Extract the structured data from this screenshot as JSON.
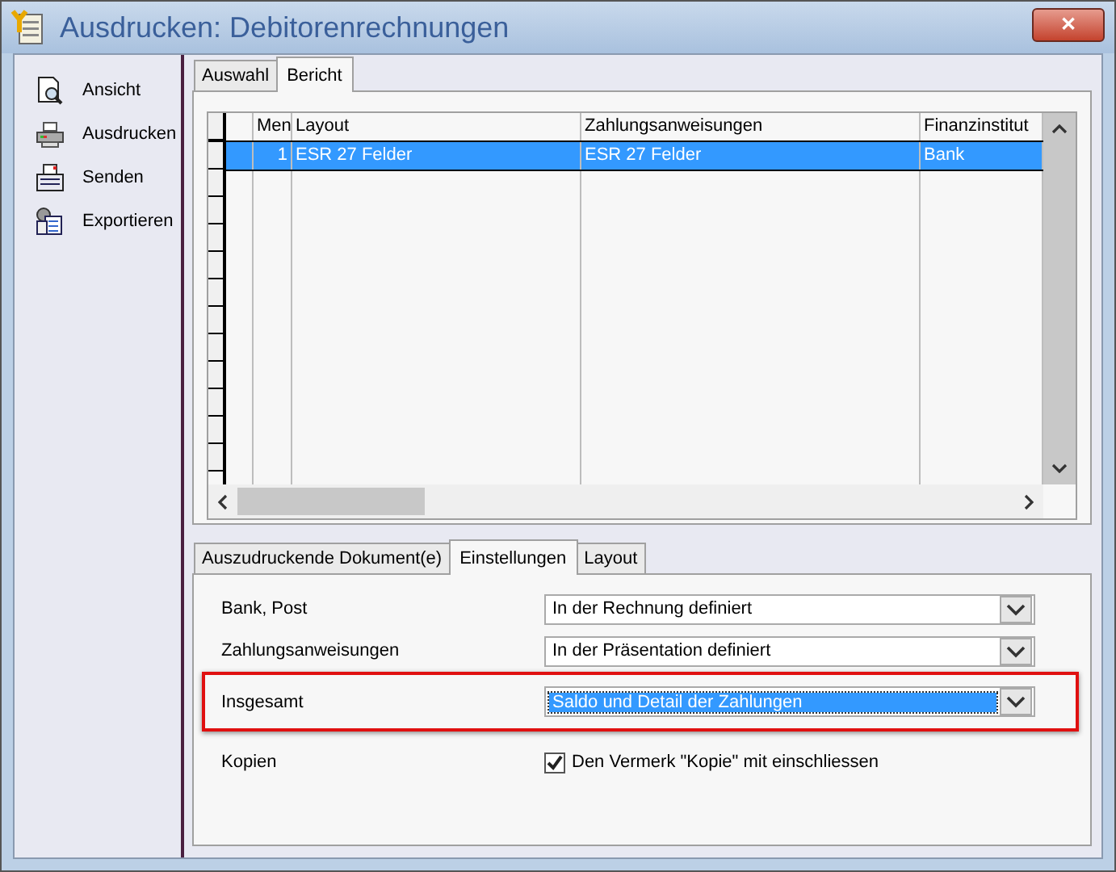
{
  "window": {
    "title": "Ausdrucken: Debitorenrechnungen",
    "close": "✕"
  },
  "sidebar": {
    "items": [
      {
        "label": "Ansicht",
        "kind": "view"
      },
      {
        "label": "Ausdrucken",
        "kind": "print"
      },
      {
        "label": "Senden",
        "kind": "send"
      },
      {
        "label": "Exportieren",
        "kind": "export"
      }
    ]
  },
  "top_tabs": [
    {
      "label": "Auswahl",
      "selected": false
    },
    {
      "label": "Bericht",
      "selected": true
    }
  ],
  "table": {
    "columns": [
      "Men",
      "Layout",
      "Zahlungsanweisungen",
      "Finanzinstitut"
    ],
    "rows": [
      {
        "cells": [
          "1",
          "ESR 27 Felder",
          "ESR 27 Felder",
          "Bank"
        ],
        "selected": true
      }
    ]
  },
  "bottom_tabs": [
    {
      "label": "Auszudruckende Dokument(e)",
      "selected": false
    },
    {
      "label": "Einstellungen",
      "selected": true
    },
    {
      "label": "Layout",
      "selected": false
    }
  ],
  "settings": [
    {
      "kind": "dropdown",
      "label": "Bank, Post",
      "value": "In der Rechnung definiert",
      "highlighted": false
    },
    {
      "kind": "dropdown",
      "label": "Zahlungsanweisungen",
      "value": "In der Präsentation definiert",
      "highlighted": false
    },
    {
      "kind": "dropdown",
      "label": "Insgesamt",
      "value": "Saldo und Detail der Zahlungen",
      "highlighted": true
    },
    {
      "kind": "checkbox",
      "label": "Kopien",
      "text": "Den Vermerk \"Kopie\" mit einschliessen",
      "checked": true
    }
  ]
}
